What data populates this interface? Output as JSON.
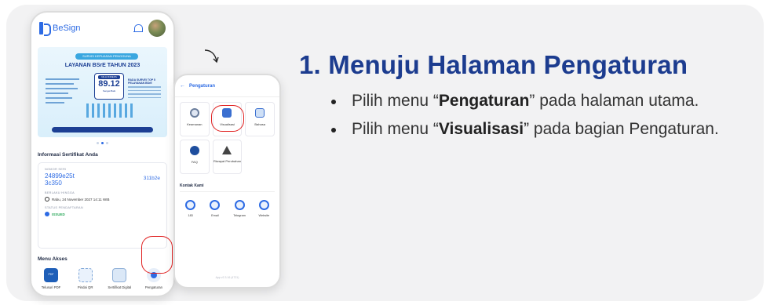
{
  "phone1": {
    "app_name": "BeSign",
    "banner": {
      "pill": "SURVEI KEPUASAN PENGGUNA",
      "title": "LAYANAN BSrE TAHUN 2023",
      "badge_label": "NILAI INDEKS",
      "badge_value": "89.12",
      "badge_sub": "Sangat Baik",
      "side_title": "RADA SURVEI TOP 5 PELAYANAN BSrE"
    },
    "section_title": "Informasi Sertifikat Anda",
    "cert": {
      "serial_label": "NOMOR SERI",
      "serial_value": "24899e25t\n3c350",
      "serial_right": "311b2e",
      "valid_label": "BERLAKU HINGGA",
      "valid_value": "Rabu, 24 November 2027 14:11 WIB",
      "status_label": "STATUS PENDAFTARAN",
      "status_value": "ISSUED"
    },
    "menu_title": "Menu Akses",
    "menu": [
      {
        "label": "Telusuri PDF"
      },
      {
        "label": "Pindai QR"
      },
      {
        "label": "Sertifikat Digital"
      },
      {
        "label": "Pengaturan"
      }
    ]
  },
  "phone2": {
    "title": "Pengaturan",
    "tiles": [
      {
        "label": "Keamanan",
        "icon": "shield-icon"
      },
      {
        "label": "Visualisasi",
        "icon": "image-icon"
      },
      {
        "label": "Bahasa",
        "icon": "language-icon"
      },
      {
        "label": "FAQ",
        "icon": "faq-icon"
      },
      {
        "label": "Riwayat Perubahan",
        "icon": "warning-icon"
      }
    ],
    "contact_title": "Kontak Kami",
    "contacts": [
      {
        "label": "183"
      },
      {
        "label": "Email"
      },
      {
        "label": "Telegram"
      },
      {
        "label": "Website"
      }
    ],
    "version": "App v2.3.16 (4721)"
  },
  "instructions": {
    "heading": "1. Menuju Halaman Pengaturan",
    "step1": {
      "pre": "Pilih menu “",
      "bold": "Pengaturan",
      "post": "” pada halaman utama."
    },
    "step2": {
      "pre": "Pilih menu “",
      "bold": "Visualisasi",
      "post": "” pada bagian Pengaturan."
    }
  },
  "colors": {
    "primary": "#2d6be4",
    "heading": "#1c3c8f",
    "highlight": "#e02020",
    "card_bg": "#f2f2f3"
  }
}
